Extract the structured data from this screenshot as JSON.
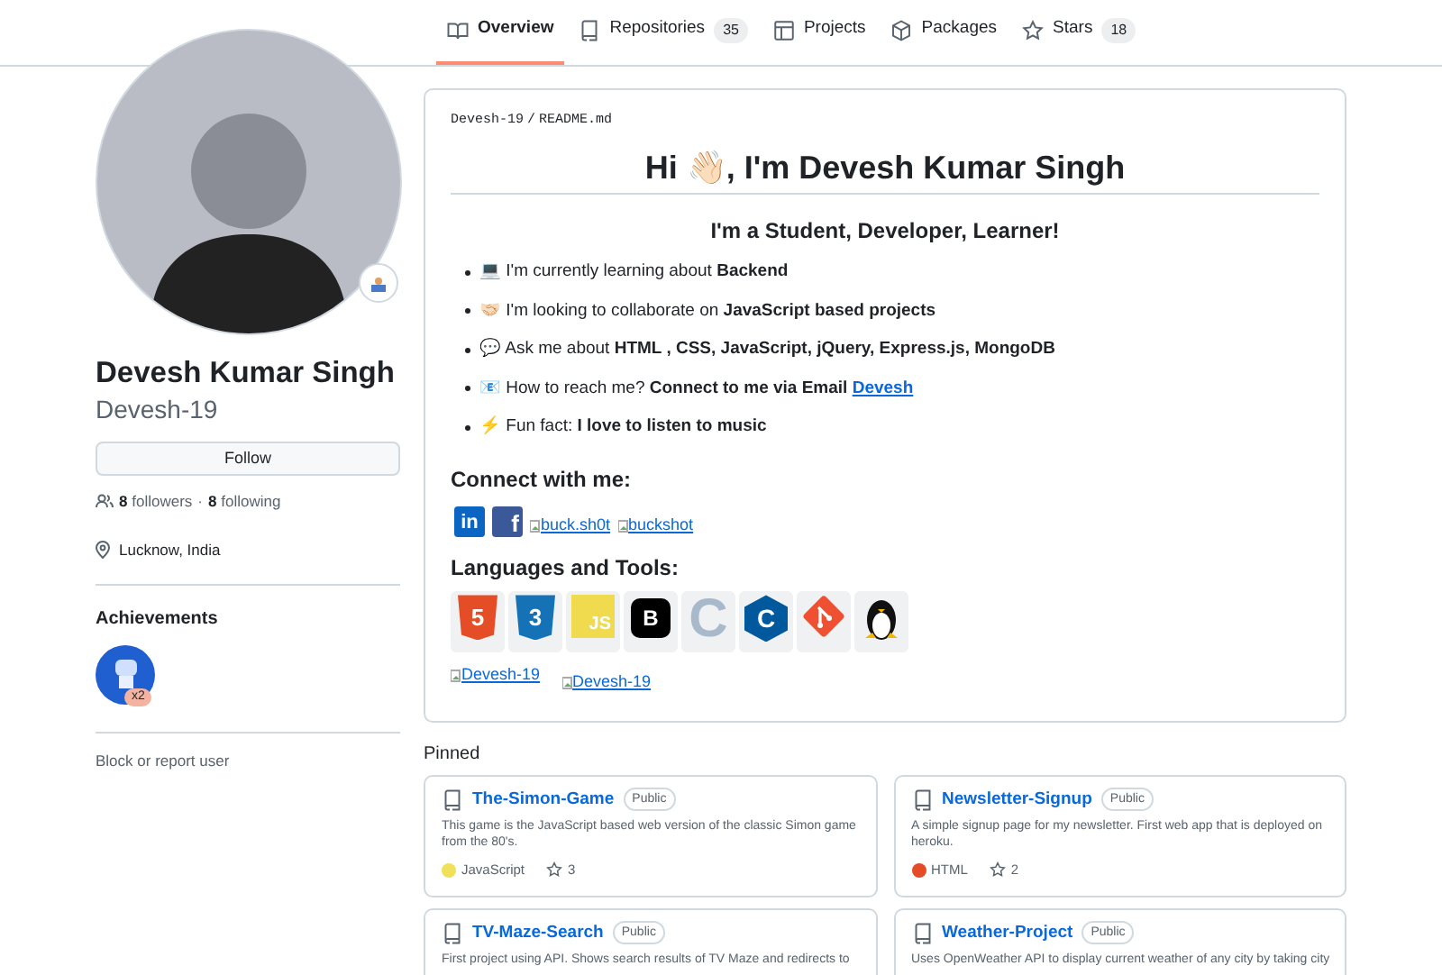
{
  "tabs": [
    {
      "label": "Overview",
      "selected": true
    },
    {
      "label": "Repositories",
      "count": "35",
      "selected": false
    },
    {
      "label": "Projects",
      "selected": false
    },
    {
      "label": "Packages",
      "selected": false
    },
    {
      "label": "Stars",
      "count": "18",
      "selected": false
    }
  ],
  "profile": {
    "name": "Devesh Kumar Singh",
    "username": "Devesh-19",
    "follow_button": "Follow",
    "followers_count": "8",
    "followers_label": "followers",
    "separator": "·",
    "following_count": "8",
    "following_label": "following",
    "location": "Lucknow, India",
    "achievements_title": "Achievements",
    "achievement_count": "x2",
    "block_link": "Block or report user"
  },
  "readme": {
    "path_owner": "Devesh-19",
    "path_sep": "/",
    "path_file": "README.md",
    "title": "Hi 👋🏻, I'm Devesh Kumar Singh",
    "subtitle": "I'm a Student, Developer, Learner!",
    "items": [
      {
        "text": "💻 I'm currently learning about **Backend**"
      },
      {
        "text": "🤝🏻 I'm looking to collaborate on **JavaScript based projects**"
      },
      {
        "text": "💬 Ask me about **HTML , CSS, JavaScript, jQuery, Express.js, MongoDB**"
      },
      {
        "text": "📧 How to reach me? **Connect to me via Email**",
        "link": "Devesh"
      },
      {
        "text": "⚡ Fun fact: **I love to listen to music**"
      }
    ],
    "connect_title": "Connect with me:",
    "socials": [
      {
        "kind": "linkedin",
        "mark": "in"
      },
      {
        "kind": "facebook",
        "mark": "f"
      },
      {
        "kind": "broken",
        "alt": "buck.sh0t"
      },
      {
        "kind": "broken",
        "alt": "buckshot"
      }
    ],
    "tools_title": "Languages and Tools:",
    "tools": [
      {
        "kind": "html",
        "mark": "5"
      },
      {
        "kind": "css",
        "mark": "3"
      },
      {
        "kind": "js",
        "mark": "JS"
      },
      {
        "kind": "bootstrap",
        "mark": "B"
      },
      {
        "kind": "c",
        "mark": "C"
      },
      {
        "kind": "cpp",
        "mark": "C"
      },
      {
        "kind": "git"
      },
      {
        "kind": "linux"
      }
    ],
    "stats": [
      {
        "alt": "Devesh-19"
      },
      {
        "alt": "Devesh-19"
      }
    ]
  },
  "pinned": {
    "title": "Pinned",
    "repos": [
      {
        "name": "The-Simon-Game",
        "visibility": "Public",
        "description": "This game is the JavaScript based web version of the classic Simon game from the 80's.",
        "language": "JavaScript",
        "color": "#f1e05a",
        "stars": "3"
      },
      {
        "name": "Newsletter-Signup",
        "visibility": "Public",
        "description": "A simple signup page for my newsletter. First web app that is deployed on heroku.",
        "language": "HTML",
        "color": "#e34c26",
        "stars": "2"
      },
      {
        "name": "TV-Maze-Search",
        "visibility": "Public",
        "description": "First project using API. Shows search results of TV Maze and redirects to"
      },
      {
        "name": "Weather-Project",
        "visibility": "Public",
        "description": "Uses OpenWeather API to display current weather of any city by taking city"
      }
    ]
  }
}
